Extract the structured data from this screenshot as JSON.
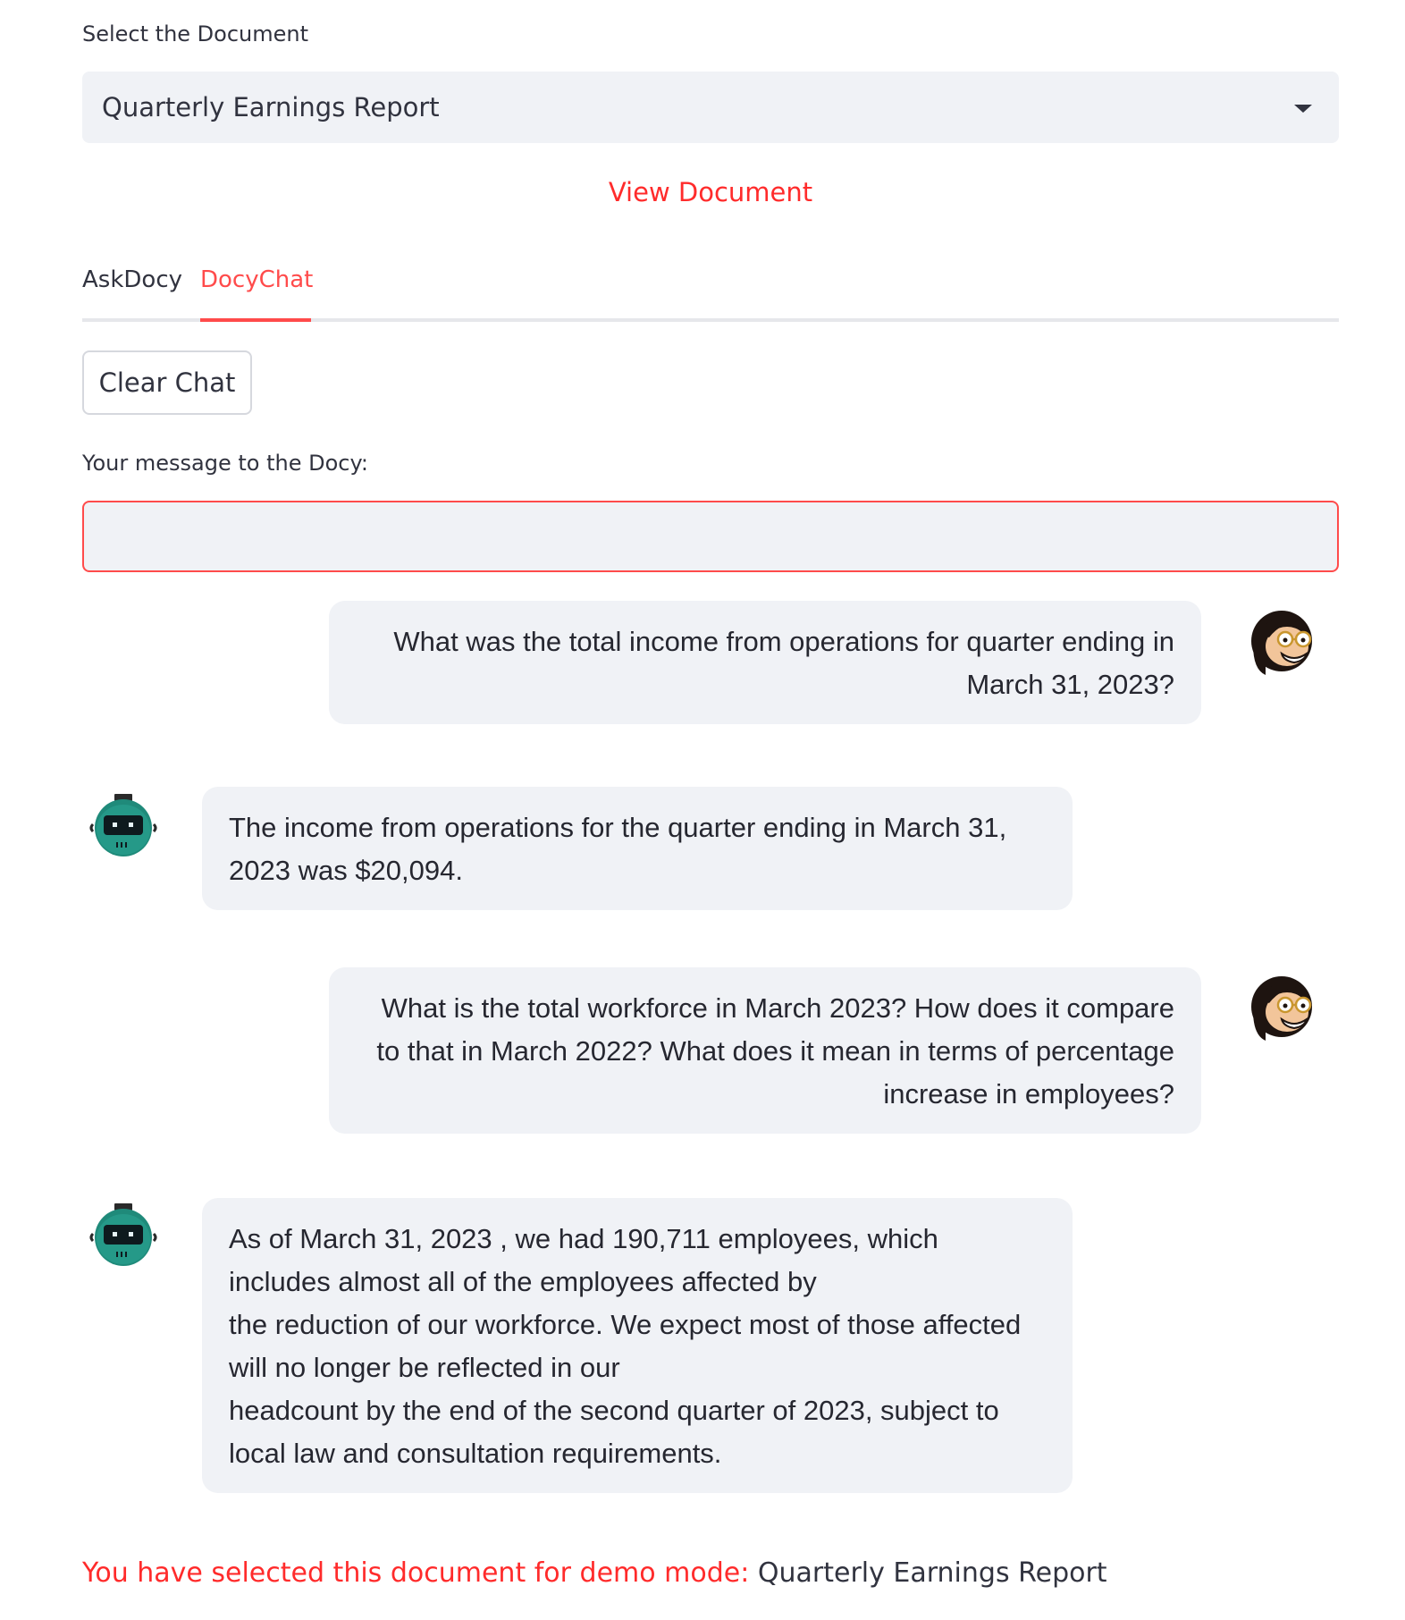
{
  "document_select": {
    "label": "Select the Document",
    "selected": "Quarterly Earnings Report"
  },
  "view_document_link": "View Document",
  "tabs": [
    {
      "label": "AskDocy",
      "active": false
    },
    {
      "label": "DocyChat",
      "active": true
    }
  ],
  "clear_chat_button": "Clear Chat",
  "message_input": {
    "label": "Your message to the Docy:",
    "value": ""
  },
  "chat": {
    "messages": [
      {
        "role": "user",
        "avatar": "woman-with-glasses-avatar",
        "lines": [
          "What was the total income from operations for quarter ending in",
          "March 31, 2023?"
        ]
      },
      {
        "role": "bot",
        "avatar": "robot-avatar",
        "lines": [
          "The income from operations for the quarter ending in March 31,",
          "2023 was $20,094."
        ]
      },
      {
        "role": "user",
        "avatar": "woman-with-glasses-avatar",
        "lines": [
          "What is the total workforce in March 2023? How does it compare",
          "to that in March 2022? What does it mean in terms of percentage",
          "increase in employees?"
        ]
      },
      {
        "role": "bot",
        "avatar": "robot-avatar",
        "lines": [
          "As of March 31, 2023 , we had 190,711 employees, which",
          "includes almost all of the employees affected by",
          "the reduction of our workforce. We expect most of those affected",
          "will no longer be reflected in our",
          "headcount by the end of the second quarter of 2023, subject to",
          "local law and consultation requirements."
        ]
      }
    ]
  },
  "footer": {
    "prefix": "You have selected this document for demo mode:",
    "document": "Quarterly Earnings Report"
  },
  "colors": {
    "accent": "#ff4b4b",
    "link": "#ff2b2b",
    "bubble_bg": "#f0f2f6",
    "text": "#31333f"
  }
}
